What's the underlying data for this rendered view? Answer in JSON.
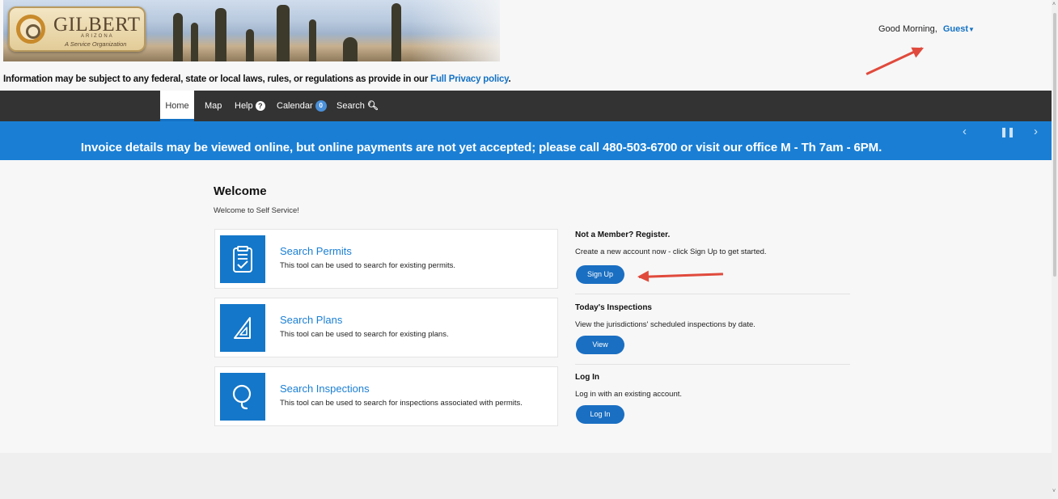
{
  "header": {
    "logo": {
      "name": "GILBERT",
      "state": "ARIZONA",
      "tagline": "A Service Organization"
    },
    "greeting": "Good Morning,",
    "user_link": "Guest",
    "privacy_text": "Information may be subject to any federal, state or local laws, rules, or regulations as provide in our",
    "privacy_link": "Full Privacy policy",
    "privacy_end": "."
  },
  "nav": {
    "items": [
      {
        "label": "Home",
        "active": true
      },
      {
        "label": "Map"
      },
      {
        "label": "Help",
        "icon": "question-circle-icon"
      },
      {
        "label": "Calendar",
        "badge": "0"
      },
      {
        "label": "Search",
        "icon": "search-icon"
      }
    ]
  },
  "announcement": {
    "text": "Invoice details may be viewed online, but online payments are not yet accepted; please call 480-503-6700 or visit our office M - Th 7am - 6PM.",
    "controls": [
      "previous-icon",
      "pause-icon",
      "next-icon"
    ]
  },
  "main": {
    "title": "Welcome",
    "subtitle": "Welcome to Self Service!",
    "cards": [
      {
        "title": "Search Permits",
        "desc": "This tool can be used to search for existing permits.",
        "icon": "clipboard-check-icon"
      },
      {
        "title": "Search Plans",
        "desc": "This tool can be used to search for existing plans.",
        "icon": "set-square-icon"
      },
      {
        "title": "Search Inspections",
        "desc": "This tool can be used to search for inspections associated with permits.",
        "icon": "magnifier-icon"
      }
    ],
    "side": [
      {
        "title": "Not a Member? Register.",
        "desc": "Create a new account now - click Sign Up to get started.",
        "button": "Sign Up"
      },
      {
        "title": "Today's Inspections",
        "desc": "View the jurisdictions' scheduled inspections by date.",
        "button": "View"
      },
      {
        "title": "Log In",
        "desc": "Log in with an existing account.",
        "button": "Log In"
      }
    ]
  },
  "colors": {
    "brand_blue": "#1a7fd4",
    "nav_dark": "#333333",
    "annotation_red": "#e04a3c"
  }
}
